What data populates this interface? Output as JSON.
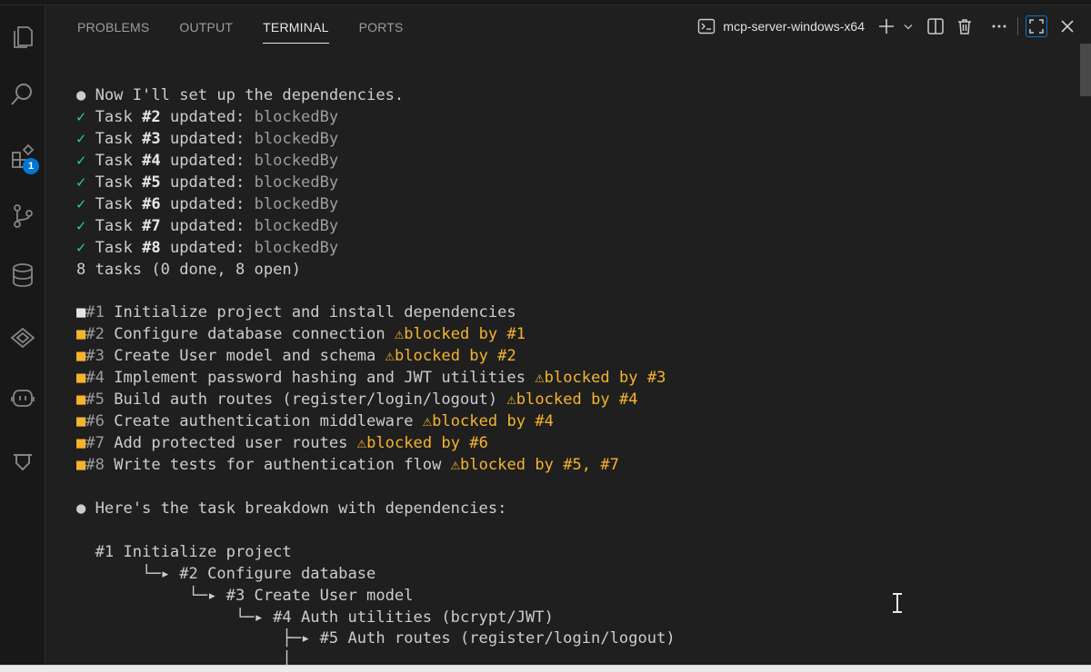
{
  "activity_bar": {
    "items": [
      {
        "icon": "explorer-icon"
      },
      {
        "icon": "search-icon"
      },
      {
        "icon": "extensions-icon",
        "badge": "1"
      },
      {
        "icon": "source-control-icon"
      },
      {
        "icon": "database-icon"
      },
      {
        "icon": "remote-explorer-icon"
      },
      {
        "icon": "copilot-icon"
      },
      {
        "icon": "testing-icon"
      }
    ]
  },
  "panel": {
    "tabs": [
      {
        "label": "PROBLEMS",
        "active": false
      },
      {
        "label": "OUTPUT",
        "active": false
      },
      {
        "label": "TERMINAL",
        "active": true
      },
      {
        "label": "PORTS",
        "active": false
      }
    ],
    "terminal_name": "mcp-server-windows-x64",
    "actions": [
      "terminal-icon",
      "add-terminal-icon",
      "chevron-down-icon",
      "split-terminal-icon",
      "trash-icon",
      "more-icon",
      "maximize-icon",
      "close-icon"
    ]
  },
  "terminal": {
    "intro": "Now I'll set up the dependencies.",
    "updates": [
      {
        "task": "#2",
        "field": "blockedBy"
      },
      {
        "task": "#3",
        "field": "blockedBy"
      },
      {
        "task": "#4",
        "field": "blockedBy"
      },
      {
        "task": "#5",
        "field": "blockedBy"
      },
      {
        "task": "#6",
        "field": "blockedBy"
      },
      {
        "task": "#7",
        "field": "blockedBy"
      },
      {
        "task": "#8",
        "field": "blockedBy"
      }
    ],
    "update_prefix": "Task ",
    "update_mid": " updated: ",
    "check": "✓",
    "bullet": "●",
    "summary": "8 tasks (0 done, 8 open)",
    "tasks": [
      {
        "id": "#1",
        "title": "Initialize project and install dependencies",
        "blocked": "",
        "color": "#e5e5e5"
      },
      {
        "id": "#2",
        "title": "Configure database connection",
        "blocked": "blocked by #1",
        "color": "#f5b32e"
      },
      {
        "id": "#3",
        "title": "Create User model and schema",
        "blocked": "blocked by #2",
        "color": "#f5b32e"
      },
      {
        "id": "#4",
        "title": "Implement password hashing and JWT utilities",
        "blocked": "blocked by #3",
        "color": "#f5b32e"
      },
      {
        "id": "#5",
        "title": "Build auth routes (register/login/logout)",
        "blocked": "blocked by #4",
        "color": "#f5b32e"
      },
      {
        "id": "#6",
        "title": "Create authentication middleware",
        "blocked": "blocked by #4",
        "color": "#f5b32e"
      },
      {
        "id": "#7",
        "title": "Add protected user routes",
        "blocked": "blocked by #6",
        "color": "#f5b32e"
      },
      {
        "id": "#8",
        "title": "Write tests for authentication flow",
        "blocked": "blocked by #5, #7",
        "color": "#f5b32e"
      }
    ],
    "breakdown_intro": "Here's the task breakdown with dependencies:",
    "tree": [
      {
        "depth": 0,
        "connector": "",
        "text": "#1 Initialize project"
      },
      {
        "depth": 1,
        "connector": "└─▸ ",
        "text": "#2 Configure database"
      },
      {
        "depth": 2,
        "connector": "└─▸ ",
        "text": "#3 Create User model"
      },
      {
        "depth": 3,
        "connector": "└─▸ ",
        "text": "#4 Auth utilities (bcrypt/JWT)"
      },
      {
        "depth": 4,
        "connector": "├─▸ ",
        "text": "#5 Auth routes (register/login/logout)"
      },
      {
        "depth": 4,
        "connector": "│",
        "text": ""
      }
    ]
  }
}
